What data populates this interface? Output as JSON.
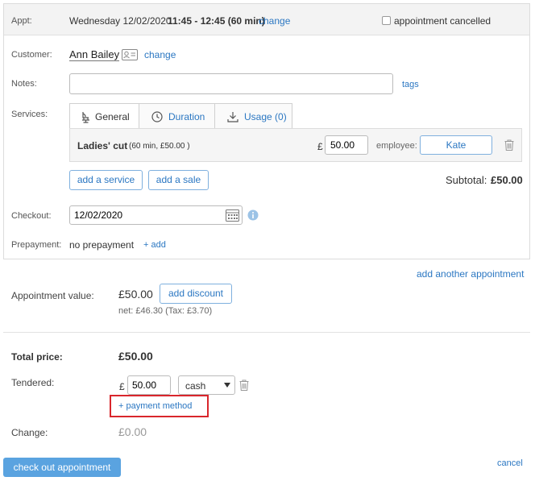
{
  "appt": {
    "label": "Appt:",
    "date": "Wednesday 12/02/2020",
    "time": "11:45 - 12:45 (60 min)",
    "change": "change",
    "cancelled_label": "appointment cancelled"
  },
  "customer": {
    "label": "Customer:",
    "name": "Ann Bailey",
    "change": "change"
  },
  "notes": {
    "label": "Notes:",
    "value": "",
    "tags": "tags"
  },
  "services": {
    "label": "Services:",
    "tabs": [
      {
        "label": "General",
        "icon": "salon-chair-icon"
      },
      {
        "label": "Duration",
        "icon": "clock-icon"
      },
      {
        "label": "Usage (0)",
        "icon": "download-icon"
      }
    ],
    "item": {
      "name": "Ladies' cut",
      "details": "(60 min, £50.00 )",
      "currency": "£",
      "price": "50.00",
      "employee_label": "employee:",
      "employee": "Kate"
    },
    "add_service": "add a service",
    "add_sale": "add a sale",
    "subtotal_label": "Subtotal:",
    "subtotal_value": "£50.00"
  },
  "checkout": {
    "label": "Checkout:",
    "date": "12/02/2020"
  },
  "prepayment": {
    "label": "Prepayment:",
    "value": "no prepayment",
    "add": "+ add"
  },
  "add_another": "add another appointment",
  "value": {
    "label": "Appointment value:",
    "amount": "£50.00",
    "add_discount": "add discount",
    "net": "net: £46.30 (Tax: £3.70)"
  },
  "total": {
    "label": "Total price:",
    "amount": "£50.00"
  },
  "tendered": {
    "label": "Tendered:",
    "currency": "£",
    "amount": "50.00",
    "method": "cash",
    "add_method": "+ payment method"
  },
  "change": {
    "label": "Change:",
    "amount": "£0.00"
  },
  "actions": {
    "checkout": "check out appointment",
    "cancel": "cancel"
  },
  "colors": {
    "link": "#2b77c2",
    "primary_button": "#5aa3e0",
    "highlight_box": "#d9262c"
  }
}
